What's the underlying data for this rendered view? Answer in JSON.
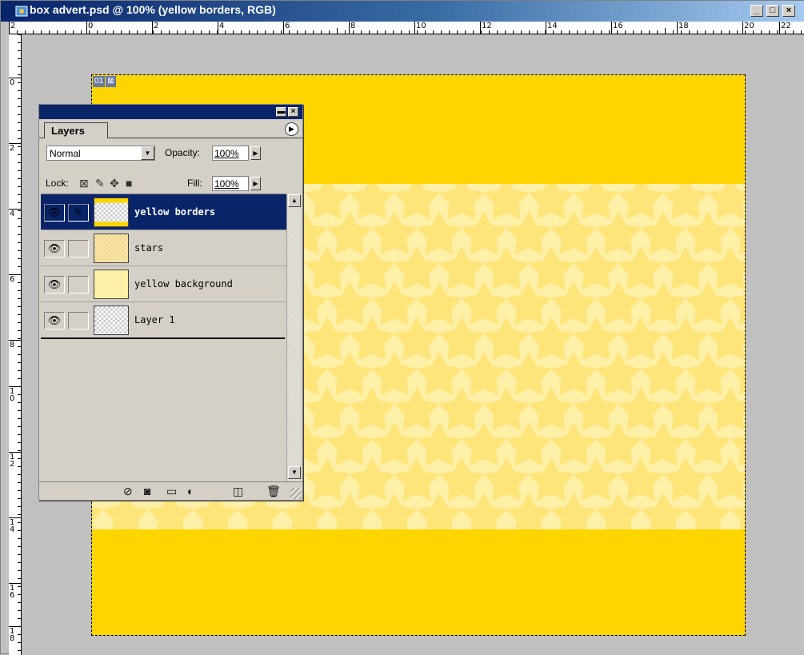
{
  "window": {
    "title": "box advert.psd @ 100% (yellow borders, RGB)",
    "minimize": "_",
    "maximize": "□",
    "close": "×"
  },
  "rulers": {
    "horizontal": [
      "2",
      "0",
      "2",
      "4",
      "6",
      "8",
      "10",
      "12",
      "14",
      "16",
      "18",
      "20",
      "22"
    ],
    "vertical": [
      "0",
      "2",
      "4",
      "6",
      "8",
      "10",
      "12",
      "14",
      "16",
      "18"
    ]
  },
  "document": {
    "badge_number": "01",
    "badge_icon": "⊠",
    "border_color": "#ffd500",
    "band_color": "#fff0a8",
    "star_color": "#ffe47a",
    "icon": "document-icon"
  },
  "layers_palette": {
    "tab_label": "Layers",
    "menu_glyph": "▶",
    "blend_mode": "Normal",
    "opacity_label": "Opacity:",
    "opacity_value": "100%",
    "lock_label": "Lock:",
    "fill_label": "Fill:",
    "fill_value": "100%",
    "layers": [
      {
        "name": "yellow borders",
        "selected": true,
        "visible": true,
        "thumb": "transparent-yellow-border"
      },
      {
        "name": "stars",
        "selected": false,
        "visible": true,
        "thumb": "stars-pattern"
      },
      {
        "name": "yellow background",
        "selected": false,
        "visible": true,
        "thumb": "pale-yellow"
      },
      {
        "name": "Layer 1",
        "selected": false,
        "visible": true,
        "thumb": "transparent"
      }
    ],
    "footer_icons": [
      "layer-style-icon",
      "mask-icon",
      "folder-icon",
      "adjustment-icon",
      "new-layer-icon",
      "trash-icon"
    ]
  }
}
